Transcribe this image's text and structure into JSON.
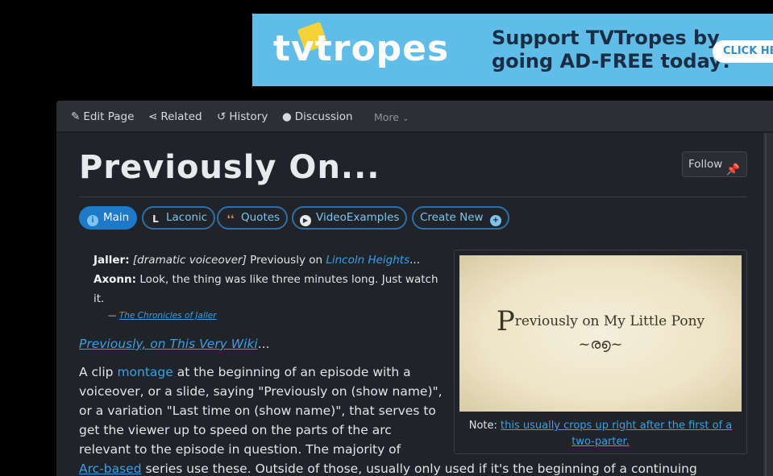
{
  "ad": {
    "logo_text": "tvtropes",
    "line1": "Support TVTropes by",
    "line2": "going AD-FREE today!",
    "cta": "CLICK HE"
  },
  "nav": {
    "edit_page": "Edit Page",
    "related": "Related",
    "history": "History",
    "discussion": "Discussion",
    "more": "More"
  },
  "page": {
    "title": "Previously On...",
    "follow_label": "Follow"
  },
  "tabs": [
    {
      "label": "Main",
      "icon": "info-icon"
    },
    {
      "label": "Laconic",
      "icon": "laconic-icon"
    },
    {
      "label": "Quotes",
      "icon": "quotes-icon"
    },
    {
      "label": "VideoExamples",
      "icon": "play-icon"
    },
    {
      "label": "Create New",
      "icon": "plus-circle-icon"
    }
  ],
  "quote": {
    "speaker1": "Jaller:",
    "stage1": "[dramatic voiceover]",
    "text1": " Previously on ",
    "link1": "Lincoln Heights",
    "text1b": "...",
    "speaker2": "Axonn:",
    "text2": " Look, the thing was like three minutes long. Just watch it.",
    "attrib_dash": "— ",
    "attrib_link": "The Chronicles of Jaller"
  },
  "see_also": {
    "link": "Previously, on This Very Wiki",
    "suffix": "..."
  },
  "body": {
    "p1_a": "A clip ",
    "p1_link": "montage",
    "p1_b": " at the beginning of an episode with a voiceover, or a slide, saying \"Previously on (show name)\", or a variation \"Last time on (show name)\", that serves to get the viewer up to speed on the parts of the arc relevant to the episode in question. The majority of",
    "p2_link": "Arc-based",
    "p2_b": " series use these. Outside of those, usually only used if it's the beginning of a continuing"
  },
  "image": {
    "big_letter": "P",
    "text": "reviously on My Little Pony",
    "flourish": "~ര൭~",
    "caption_prefix": "Note: ",
    "caption_link": "this usually crops up right after the first of a two-parter."
  }
}
